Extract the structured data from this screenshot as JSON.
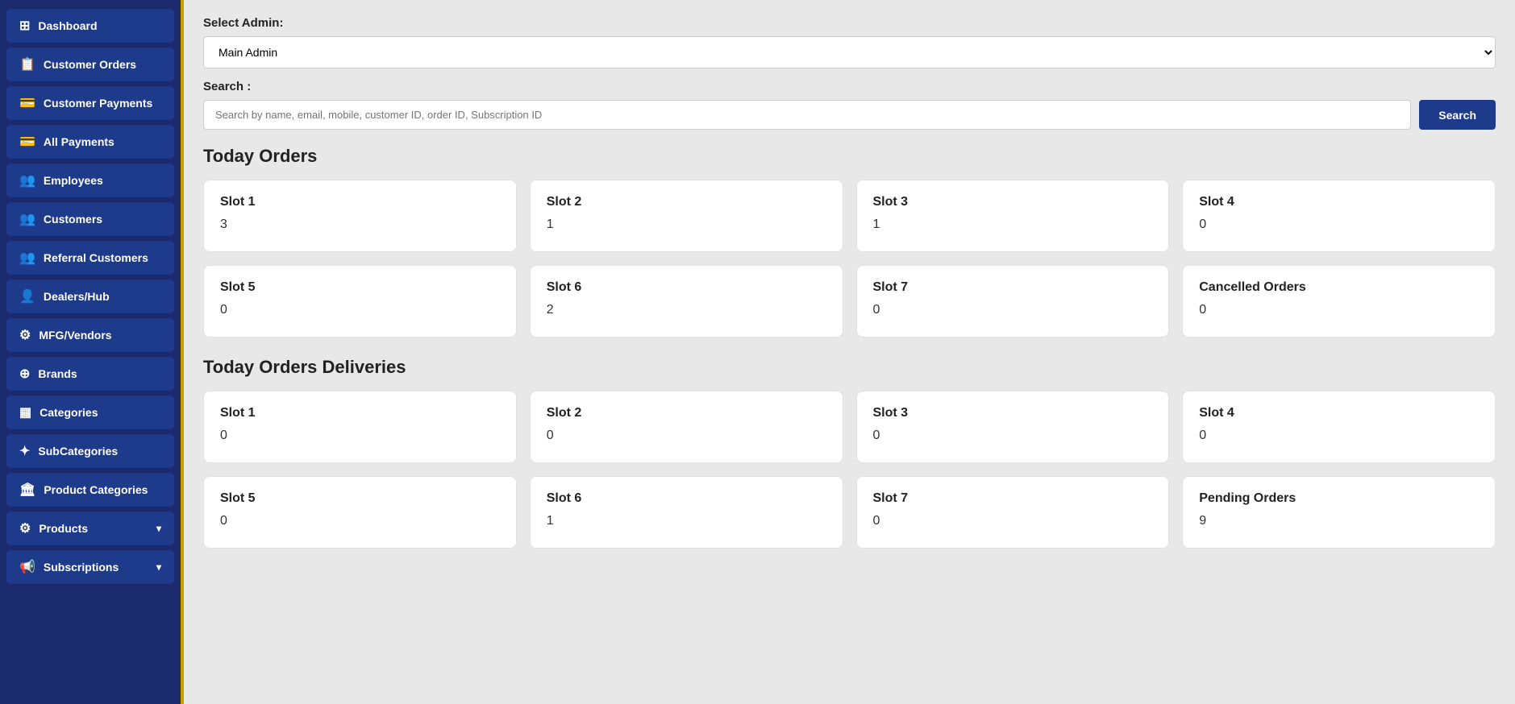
{
  "sidebar": {
    "items": [
      {
        "id": "dashboard",
        "label": "Dashboard",
        "icon": "⊞"
      },
      {
        "id": "customer-orders",
        "label": "Customer Orders",
        "icon": "📋"
      },
      {
        "id": "customer-payments",
        "label": "Customer Payments",
        "icon": "💳"
      },
      {
        "id": "all-payments",
        "label": "All Payments",
        "icon": "💳"
      },
      {
        "id": "employees",
        "label": "Employees",
        "icon": "👥"
      },
      {
        "id": "customers",
        "label": "Customers",
        "icon": "👥"
      },
      {
        "id": "referral-customers",
        "label": "Referral Customers",
        "icon": "👥"
      },
      {
        "id": "dealers-hub",
        "label": "Dealers/Hub",
        "icon": "👤"
      },
      {
        "id": "mfg-vendors",
        "label": "MFG/Vendors",
        "icon": "⚙"
      },
      {
        "id": "brands",
        "label": "Brands",
        "icon": "⊕"
      },
      {
        "id": "categories",
        "label": "Categories",
        "icon": "▦"
      },
      {
        "id": "subcategories",
        "label": "SubCategories",
        "icon": "✦"
      },
      {
        "id": "product-categories",
        "label": "Product Categories",
        "icon": "🏛"
      },
      {
        "id": "products",
        "label": "Products",
        "icon": "⚙",
        "hasArrow": true
      },
      {
        "id": "subscriptions",
        "label": "Subscriptions",
        "icon": "📢",
        "hasArrow": true
      }
    ]
  },
  "header": {
    "select_admin_label": "Select Admin:",
    "select_admin_value": "Main Admin",
    "search_label": "Search :",
    "search_placeholder": "Search by name, email, mobile, customer ID, order ID, Subscription ID",
    "search_button_label": "Search"
  },
  "today_orders": {
    "title": "Today Orders",
    "cards": [
      {
        "label": "Slot 1",
        "value": "3"
      },
      {
        "label": "Slot 2",
        "value": "1"
      },
      {
        "label": "Slot 3",
        "value": "1"
      },
      {
        "label": "Slot 4",
        "value": "0"
      },
      {
        "label": "Slot 5",
        "value": "0"
      },
      {
        "label": "Slot 6",
        "value": "2"
      },
      {
        "label": "Slot 7",
        "value": "0"
      },
      {
        "label": "Cancelled Orders",
        "value": "0"
      }
    ]
  },
  "today_deliveries": {
    "title": "Today Orders Deliveries",
    "cards": [
      {
        "label": "Slot 1",
        "value": "0"
      },
      {
        "label": "Slot 2",
        "value": "0"
      },
      {
        "label": "Slot 3",
        "value": "0"
      },
      {
        "label": "Slot 4",
        "value": "0"
      },
      {
        "label": "Slot 5",
        "value": "0"
      },
      {
        "label": "Slot 6",
        "value": "1"
      },
      {
        "label": "Slot 7",
        "value": "0"
      },
      {
        "label": "Pending Orders",
        "value": "9"
      }
    ]
  }
}
